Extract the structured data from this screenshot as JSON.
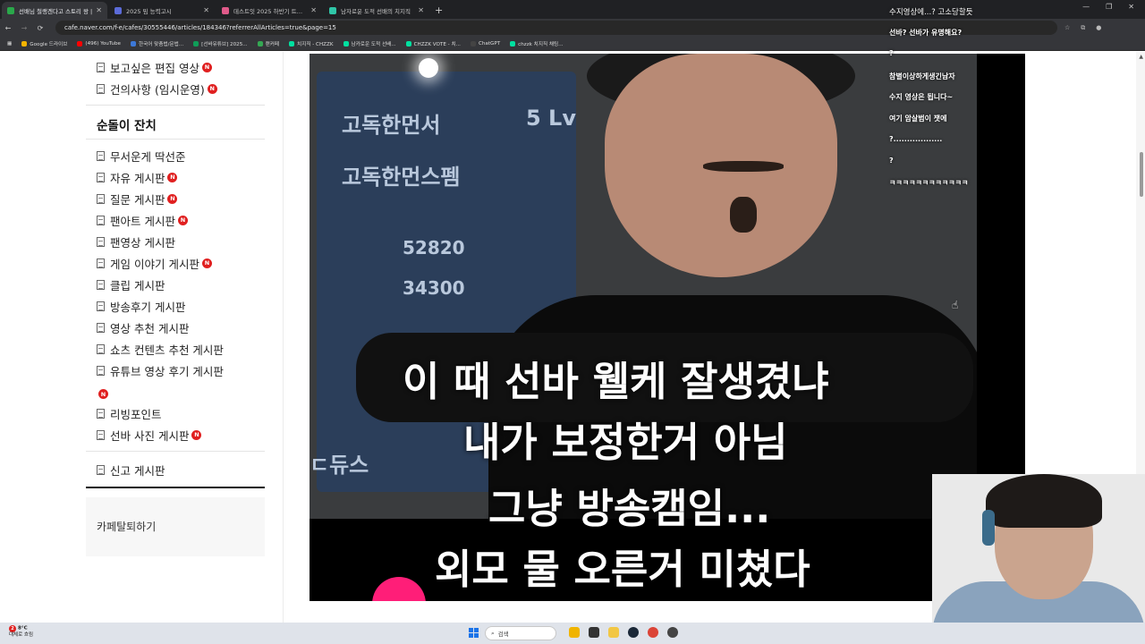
{
  "browser": {
    "tabs": [
      {
        "title": "선배님 철랭겐다고 스토리 왕 |",
        "active": true,
        "color": "#2aa84a"
      },
      {
        "title": "2025 밈 능력고시",
        "active": false,
        "color": "#5b6bd8"
      },
      {
        "title": "데스트잇 2025 하반기 트렌드",
        "active": false,
        "color": "#e05a8a"
      },
      {
        "title": "남자로운 도적 선배의 치지직",
        "active": false,
        "color": "#2fc6a8"
      }
    ],
    "new_tab": "+",
    "url": "cafe.naver.com/f-e/cafes/30555446/articles/184346?referrerAllArticles=true&page=15",
    "bookmarks": [
      {
        "label": "Google 드라이브",
        "color": "#f4b400"
      },
      {
        "label": "(496) YouTube",
        "color": "#ff0000"
      },
      {
        "label": "한국어 맞춤법/문법...",
        "color": "#3c78d8"
      },
      {
        "label": "[선바유튜브] 2025...",
        "color": "#0f9d58"
      },
      {
        "label": "랜커페",
        "color": "#34a853"
      },
      {
        "label": "치지직 - CHZZK",
        "color": "#00e0a0"
      },
      {
        "label": "남카로운 도적 선배...",
        "color": "#00e0a0"
      },
      {
        "label": "CHZZK VOTE - 치...",
        "color": "#00e0a0"
      },
      {
        "label": "ChatGPT",
        "color": "#444"
      },
      {
        "label": "chzzk 치지직 채팅...",
        "color": "#00e0a0"
      }
    ]
  },
  "sidebar": {
    "top_items": [
      {
        "label": "보고싶은 편집 영상",
        "new": true
      },
      {
        "label": "건의사항 (임시운영)",
        "new": true
      }
    ],
    "section_title": "순돌이 잔치",
    "items": [
      {
        "label": "무서운게 딱선준",
        "new": false
      },
      {
        "label": "자유 게시판",
        "new": true
      },
      {
        "label": "질문 게시판",
        "new": true
      },
      {
        "label": "팬아트 게시판",
        "new": true
      },
      {
        "label": "팬영상 게시판",
        "new": false
      },
      {
        "label": "게임 이야기 게시판",
        "new": true
      },
      {
        "label": "클립 게시판",
        "new": false
      },
      {
        "label": "방송후기 게시판",
        "new": false
      },
      {
        "label": "영상 추천 게시판",
        "new": false
      },
      {
        "label": "쇼츠 컨텐츠 추천 게시판",
        "new": false
      },
      {
        "label": "유튜브 영상 후기 게시판",
        "new": true
      },
      {
        "label": "리빙포인트",
        "new": false
      },
      {
        "label": "선바 사진 게시판",
        "new": true
      }
    ],
    "report_board": "신고 게시판",
    "leave_cafe": "카페탈퇴하기",
    "new_badge": "N"
  },
  "video": {
    "panel_texts": [
      "고독한먼서",
      "5 Lv",
      "고독한먼스펨",
      "52820",
      "34300",
      "ㄷ듀스"
    ],
    "subtitles": [
      "이 때 선바 웰케 잘생겼냐",
      "내가 보정한거 아님",
      "그냥 방송캠임...",
      "외모 물 오른거 미쳤다"
    ]
  },
  "chat": [
    "수지영상에...? 고소당할듯",
    "선바? 선바가 유명해요?",
    "?",
    "참별이상하게생긴남자",
    "수지 영상은 됩니다~",
    "여기 암살범이 잿에",
    "?..................",
    "?",
    "ㅋㅋㅋㅋㅋㅋㅋㅋㅋㅋㅋㅋ"
  ],
  "taskbar": {
    "weather_temp": "8°C",
    "weather_desc": "대체로 흐림",
    "search_placeholder": "검색",
    "notification_count": "2"
  },
  "colors": {
    "new_badge": "#e02020",
    "chrome_dark": "#202124",
    "taskbar": "#dfe3ea"
  }
}
